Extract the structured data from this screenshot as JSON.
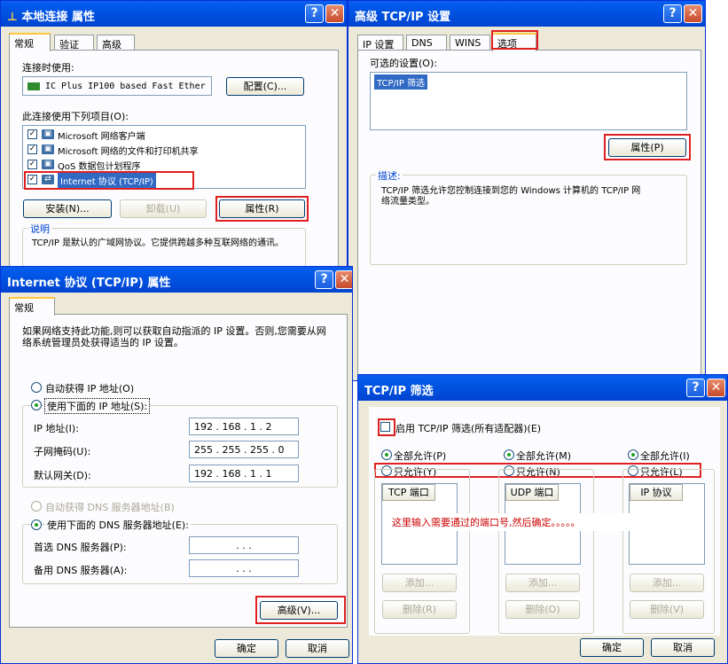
{
  "w1": {
    "title": "本地连接 属性",
    "help": "?",
    "close": "✕",
    "tabs": [
      "常规",
      "验证",
      "高级"
    ],
    "connect_using": "连接时使用:",
    "adapter": "IC Plus IP100 based Fast Ether",
    "config": "配置(C)...",
    "items_label": "此连接使用下列项目(O):",
    "items": [
      "Microsoft 网络客户端",
      "Microsoft 网络的文件和打印机共享",
      "QoS 数据包计划程序",
      "Internet 协议 (TCP/IP)"
    ],
    "install": "安装(N)...",
    "uninstall": "卸载(U)",
    "props": "属性(R)",
    "desc_title": "说明",
    "desc": "TCP/IP 是默认的广域网协议。它提供跨越多种互联网络的通讯。"
  },
  "w2": {
    "title": "高级 TCP/IP 设置",
    "help": "?",
    "close": "✕",
    "tabs": [
      "IP 设置",
      "DNS",
      "WINS",
      "选项"
    ],
    "optional": "可选的设置(O):",
    "selected": "TCP/IP 筛选",
    "props": "属性(P)",
    "desc_title": "描述:",
    "desc": "TCP/IP 筛选允许您控制连接到您的 Windows 计算机的 TCP/IP 网络流量类型。"
  },
  "w3": {
    "title": "Internet 协议 (TCP/IP) 属性",
    "help": "?",
    "close": "✕",
    "tab": "常规",
    "intro": "如果网络支持此功能,则可以获取自动指派的 IP 设置。否则,您需要从网络系统管理员处获得适当的 IP 设置。",
    "auto_ip": "自动获得 IP 地址(O)",
    "use_ip": "使用下面的 IP 地址(S):",
    "ip_label": "IP 地址(I):",
    "ip": "192 . 168 .  1  .  2",
    "mask_label": "子网掩码(U):",
    "mask": "255 . 255 . 255 .  0",
    "gw_label": "默认网关(D):",
    "gw": "192 . 168 .  1  .  1",
    "auto_dns": "自动获得 DNS 服务器地址(B)",
    "use_dns": "使用下面的 DNS 服务器地址(E):",
    "dns1_label": "首选 DNS 服务器(P):",
    "dns2_label": "备用 DNS 服务器(A):",
    "dns_empty": ".       .       .",
    "advanced": "高级(V)...",
    "ok": "确定",
    "cancel": "取消"
  },
  "w4": {
    "title": "TCP/IP 筛选",
    "help": "?",
    "close": "✕",
    "enable": "启用 TCP/IP 筛选(所有适配器)(E)",
    "allow_all": [
      "全部允许(P)",
      "全部允许(M)",
      "全部允许(I)"
    ],
    "allow_only": [
      "只允许(Y)",
      "只允许(N)",
      "只允许(L)"
    ],
    "headers": [
      "TCP 端口",
      "UDP 端口",
      "IP 协议"
    ],
    "note": "这里输入需要通过的端口号,然后确定。。。。。",
    "add": [
      "添加...",
      "添加...",
      "添加..."
    ],
    "remove": [
      "删除(R)",
      "删除(O)",
      "删除(V)"
    ],
    "ok": "确定",
    "cancel": "取消"
  },
  "colors": {
    "title_bar": "#0054e3",
    "annotation": "#e02020",
    "note_text": "#cc0000"
  }
}
